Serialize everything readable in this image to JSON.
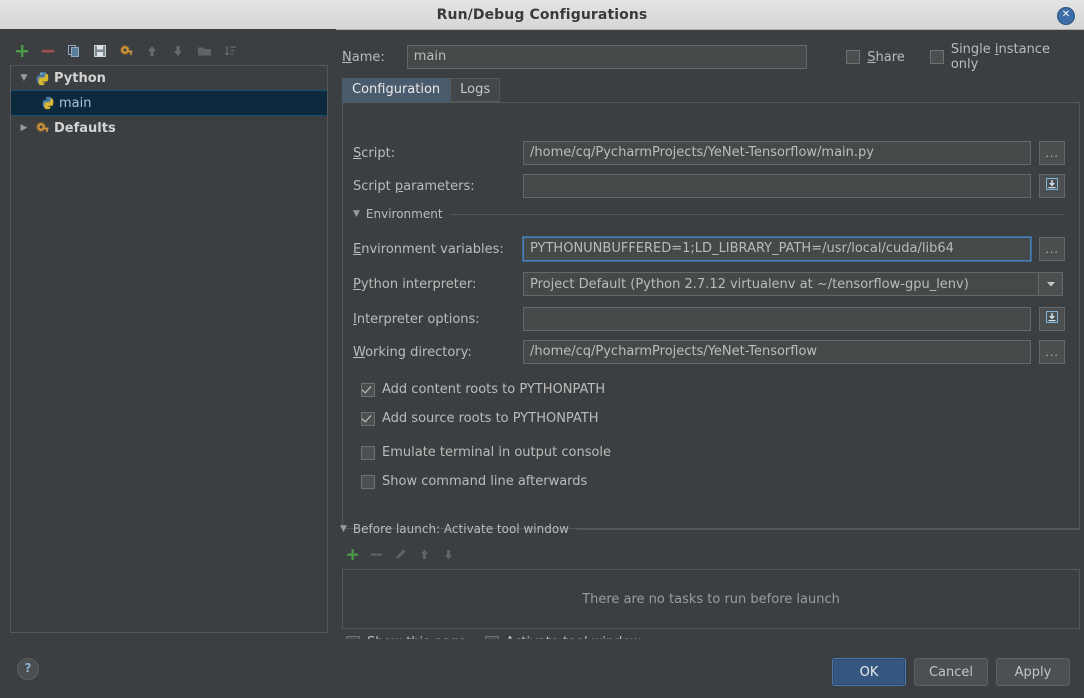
{
  "window": {
    "title": "Run/Debug Configurations",
    "close_icon": "close-icon"
  },
  "sidebar": {
    "toolbar": [
      {
        "name": "add-configuration-icon",
        "glyph": "+",
        "enabled": true
      },
      {
        "name": "remove-configuration-icon",
        "glyph": "–",
        "enabled": true
      },
      {
        "name": "copy-configuration-icon",
        "glyph": "❐",
        "enabled": true
      },
      {
        "name": "save-configuration-icon",
        "glyph": "▣",
        "enabled": true
      },
      {
        "name": "edit-defaults-icon",
        "glyph": "⚙",
        "enabled": true
      },
      {
        "name": "move-up-icon",
        "glyph": "↑",
        "enabled": false
      },
      {
        "name": "move-down-icon",
        "glyph": "↓",
        "enabled": false
      },
      {
        "name": "folder-icon",
        "glyph": "▬",
        "enabled": false
      },
      {
        "name": "sort-icon",
        "glyph": "⇅",
        "enabled": false
      }
    ],
    "tree": [
      {
        "label": "Python",
        "icon": "python-icon",
        "expanded": true,
        "selected": false,
        "level": 0,
        "bold": true
      },
      {
        "label": "main",
        "icon": "python-icon",
        "expanded": null,
        "selected": true,
        "level": 1,
        "bold": false
      },
      {
        "label": "Defaults",
        "icon": "defaults-icon",
        "expanded": false,
        "selected": false,
        "level": 0,
        "bold": true
      }
    ]
  },
  "header": {
    "name_label": "Name:",
    "name_value": "main",
    "share_label": "Share",
    "share_checked": false,
    "single_instance_label": "Single instance only",
    "single_instance_checked": false
  },
  "tabs": [
    {
      "label": "Configuration",
      "active": true
    },
    {
      "label": "Logs",
      "active": false
    }
  ],
  "configuration": {
    "script": {
      "label": "Script:",
      "value": "/home/cq/PycharmProjects/YeNet-Tensorflow/main.py",
      "browse_label": "..."
    },
    "script_parameters": {
      "label": "Script parameters:",
      "value": "",
      "expand_icon": "expand-editor-icon"
    },
    "environment_section": {
      "label": "Environment",
      "expanded": true
    },
    "environment_variables": {
      "label": "Environment variables:",
      "value": "PYTHONUNBUFFERED=1;LD_LIBRARY_PATH=/usr/local/cuda/lib64",
      "focused": true,
      "browse_label": "..."
    },
    "python_interpreter": {
      "label": "Python interpreter:",
      "value": "Project Default (Python 2.7.12 virtualenv at ~/tensorflow-gpu_lenv)",
      "dropdown_icon": "chevron-down-icon"
    },
    "interpreter_options": {
      "label": "Interpreter options:",
      "value": "",
      "expand_icon": "expand-editor-icon"
    },
    "working_directory": {
      "label": "Working directory:",
      "value": "/home/cq/PycharmProjects/YeNet-Tensorflow",
      "browse_label": "..."
    },
    "checkboxes": [
      {
        "label": "Add content roots to PYTHONPATH",
        "checked": true,
        "name": "add-content-roots-checkbox"
      },
      {
        "label": "Add source roots to PYTHONPATH",
        "checked": true,
        "name": "add-source-roots-checkbox"
      },
      {
        "label": "Emulate terminal in output console",
        "checked": false,
        "name": "emulate-terminal-checkbox"
      },
      {
        "label": "Show command line afterwards",
        "checked": false,
        "name": "show-command-line-checkbox"
      }
    ]
  },
  "before_launch": {
    "header": "Before launch: Activate tool window",
    "expanded": true,
    "toolbar": [
      {
        "name": "add-task-icon",
        "glyph": "+",
        "enabled": true
      },
      {
        "name": "remove-task-icon",
        "glyph": "–",
        "enabled": false
      },
      {
        "name": "edit-task-icon",
        "glyph": "✎",
        "enabled": false
      },
      {
        "name": "move-task-up-icon",
        "glyph": "↑",
        "enabled": false
      },
      {
        "name": "move-task-down-icon",
        "glyph": "↓",
        "enabled": false
      }
    ],
    "empty_text": "There are no tasks to run before launch",
    "show_this_page": {
      "label": "Show this page",
      "checked": false
    },
    "activate_tool_window": {
      "label": "Activate tool window",
      "checked": true
    }
  },
  "footer": {
    "help_glyph": "?",
    "buttons": [
      {
        "label": "OK",
        "primary": true,
        "name": "ok-button"
      },
      {
        "label": "Cancel",
        "primary": false,
        "name": "cancel-button"
      },
      {
        "label": "Apply",
        "primary": false,
        "name": "apply-button"
      }
    ]
  },
  "colors": {
    "window_bg": "#3c3f41",
    "titlebar_bg": "#dedede",
    "accent_blue": "#365880",
    "selection_blue": "#0d293e",
    "tab_active": "#4b5b6e",
    "field_bg": "#45494a",
    "focus_border": "#4a7eb8",
    "text": "#bbbbbb"
  }
}
